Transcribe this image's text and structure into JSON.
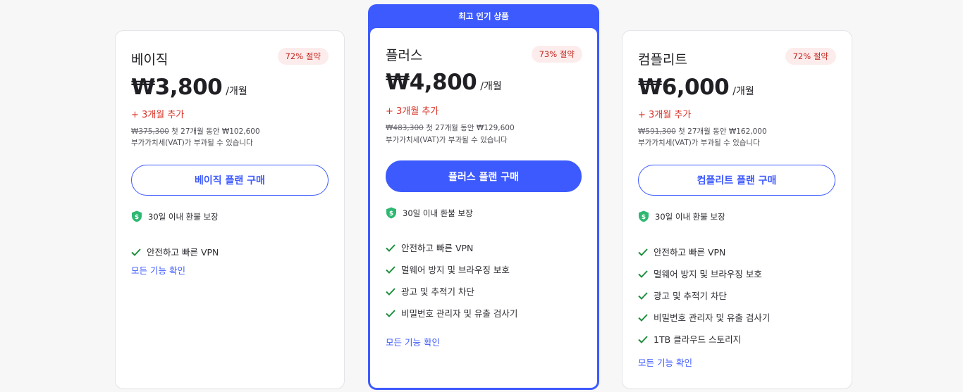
{
  "plans": {
    "basic": {
      "name": "베이직",
      "badge": "72% 절약",
      "price": "₩3,800",
      "per": "/개월",
      "bonus": "+ 3개월 추가",
      "original_price": "₩375,300",
      "billing_text": " 첫 27개월 동안 ₩102,600",
      "vat": "부가가치세(VAT)가 부과될 수 있습니다",
      "cta": "베이직 플랜 구매",
      "guarantee": "30일 이내 환불 보장",
      "features": [
        "안전하고 빠른 VPN"
      ],
      "all_features": "모든 기능 확인"
    },
    "plus": {
      "banner": "최고 인기 상품",
      "name": "플러스",
      "badge": "73% 절약",
      "price": "₩4,800",
      "per": "/개월",
      "bonus": "+ 3개월 추가",
      "original_price": "₩483,300",
      "billing_text": " 첫 27개월 동안 ₩129,600",
      "vat": "부가가치세(VAT)가 부과될 수 있습니다",
      "cta": "플러스 플랜 구매",
      "guarantee": "30일 이내 환불 보장",
      "features": [
        "안전하고 빠른 VPN",
        "멀웨어 방지 및 브라우징 보호",
        "광고 및 추적기 차단",
        "비밀번호 관리자 및 유출 검사기"
      ],
      "all_features": "모든 기능 확인"
    },
    "complete": {
      "name": "컴플리트",
      "badge": "72% 절약",
      "price": "₩6,000",
      "per": "/개월",
      "bonus": "+ 3개월 추가",
      "original_price": "₩591,300",
      "billing_text": " 첫 27개월 동안 ₩162,000",
      "vat": "부가가치세(VAT)가 부과될 수 있습니다",
      "cta": "컴플리트 플랜 구매",
      "guarantee": "30일 이내 환불 보장",
      "features": [
        "안전하고 빠른 VPN",
        "멀웨어 방지 및 브라우징 보호",
        "광고 및 추적기 차단",
        "비밀번호 관리자 및 유출 검사기",
        "1TB 클라우드 스토리지"
      ],
      "all_features": "모든 기능 확인"
    }
  },
  "colors": {
    "accent": "#3d5afe",
    "badge_bg": "#fdecec",
    "badge_text": "#c3261f",
    "bonus": "#d93025",
    "check": "#1e8e3e",
    "shield": "#2eb872"
  },
  "icons": {
    "guarantee": "shield-check-icon",
    "feature": "check-icon"
  }
}
